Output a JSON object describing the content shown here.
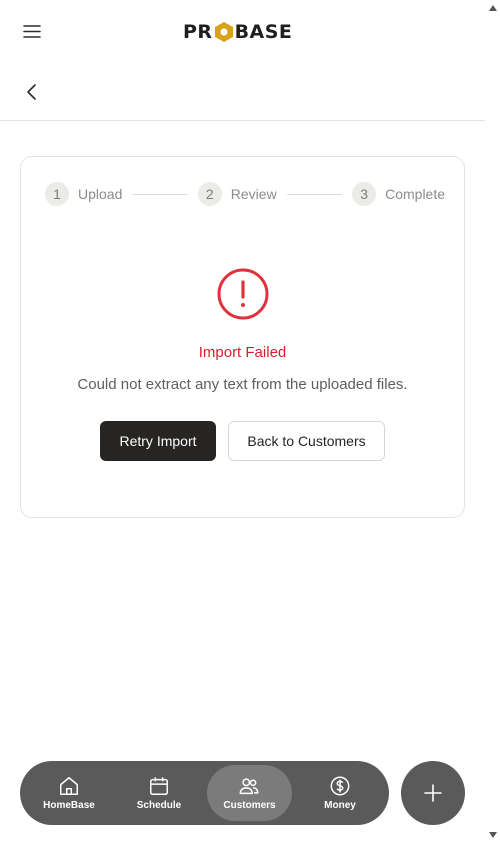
{
  "header": {
    "logo_left": "PR",
    "logo_right": "BASE",
    "logo_accent": "#d9a21b"
  },
  "steps": [
    {
      "number": "1",
      "label": "Upload"
    },
    {
      "number": "2",
      "label": "Review"
    },
    {
      "number": "3",
      "label": "Complete"
    }
  ],
  "status": {
    "icon": "alert-circle-icon",
    "title": "Import Failed",
    "message": "Could not extract any text from the uploaded files.",
    "color": "#d4212c"
  },
  "actions": {
    "retry_label": "Retry Import",
    "back_label": "Back to Customers"
  },
  "nav": {
    "items": [
      {
        "label": "HomeBase",
        "icon": "home-icon",
        "active": false
      },
      {
        "label": "Schedule",
        "icon": "calendar-icon",
        "active": false
      },
      {
        "label": "Customers",
        "icon": "users-icon",
        "active": true
      },
      {
        "label": "Money",
        "icon": "dollar-icon",
        "active": false
      }
    ],
    "fab_icon": "plus-icon"
  }
}
